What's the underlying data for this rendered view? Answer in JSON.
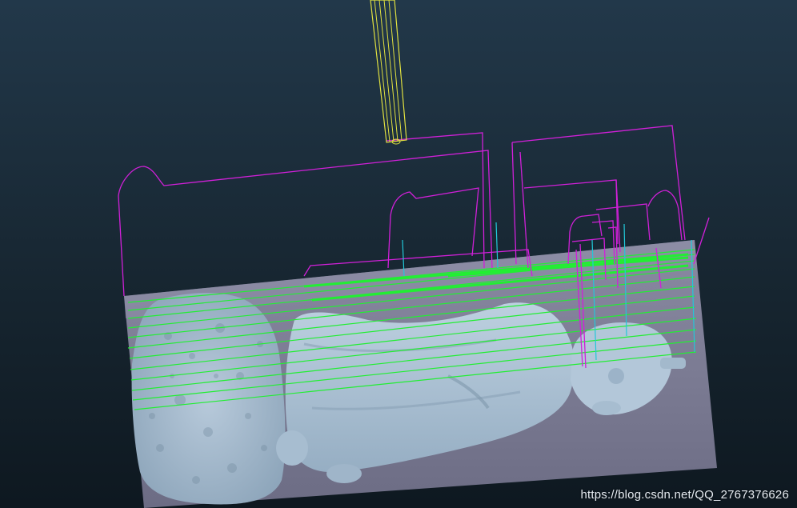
{
  "viewport": {
    "background_top": "#233746",
    "background_bottom": "#0f1a22"
  },
  "colors": {
    "stock": "#7f7f96",
    "stock_edge": "#6a6a82",
    "model": "#a3b9cc",
    "model_shadow": "#7f97ab",
    "toolpath_retract": "#d020d8",
    "toolpath_cut": "#22ee33",
    "toolpath_plunge": "#22c8d8",
    "tool": "#e0e040"
  },
  "watermark": {
    "text": "https://blog.csdn.net/QQ_2767376626"
  }
}
